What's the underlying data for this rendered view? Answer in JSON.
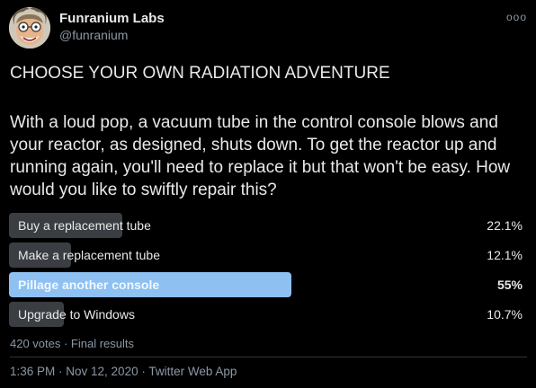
{
  "tweet": {
    "author_name": "Funranium Labs",
    "author_handle": "@funranium",
    "more_label": "ooo",
    "title": "CHOOSE YOUR OWN RADIATION ADVENTURE",
    "body": "With a loud pop, a vacuum tube in the control console blows and your reactor, as designed, shuts down. To get the reactor up and running again, you'll need to replace it but that won't be easy. How would you like to swiftly repair this?"
  },
  "poll": {
    "options": [
      {
        "label": "Buy a replacement tube",
        "percent_text": "22.1%",
        "percent": 22.1,
        "winner": false
      },
      {
        "label": "Make a replacement tube",
        "percent_text": "12.1%",
        "percent": 12.1,
        "winner": false
      },
      {
        "label": "Pillage another console",
        "percent_text": "55%",
        "percent": 55,
        "winner": true
      },
      {
        "label": "Upgrade to Windows",
        "percent_text": "10.7%",
        "percent": 10.7,
        "winner": false
      }
    ],
    "summary": "420 votes · Final results"
  },
  "footer": {
    "timestamp": "1:36 PM · Nov 12, 2020 · Twitter Web App"
  },
  "colors": {
    "background": "#000000",
    "bar": "#3a3d41",
    "winner_bar": "#8ec0f2",
    "muted_text": "#8b98a5"
  }
}
